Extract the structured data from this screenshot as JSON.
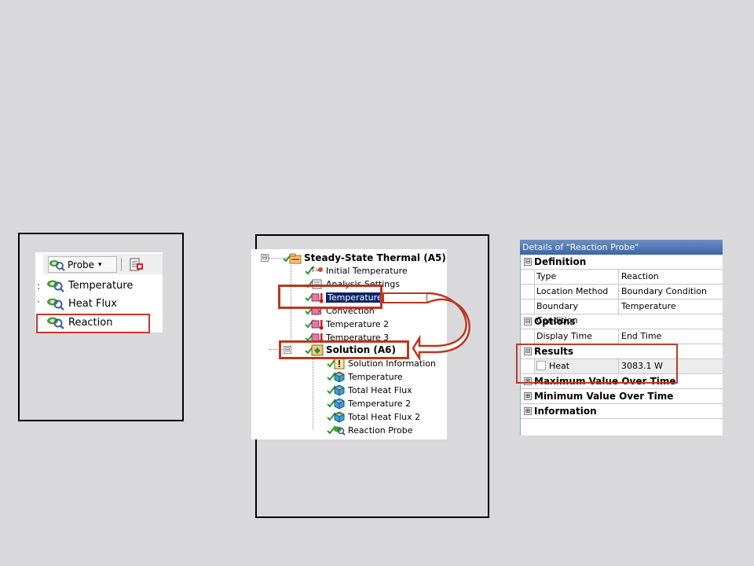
{
  "probe_menu": {
    "button_label": "Probe",
    "dropdown_glyph": "▾",
    "stub_glyphs": [
      ":",
      "·"
    ],
    "items": [
      {
        "label": "Temperature",
        "icon": "probe-icon"
      },
      {
        "label": "Heat Flux",
        "icon": "probe-icon"
      },
      {
        "label": "Reaction",
        "icon": "probe-icon"
      }
    ],
    "highlighted_item": "Reaction"
  },
  "tree": {
    "root": {
      "label": "Steady-State Thermal (A5)",
      "icon": "thermal-folder-icon",
      "expander": "⊟"
    },
    "analysis_children": [
      {
        "label": "Initial Temperature",
        "icon": "initial-temp-icon"
      },
      {
        "label": "Analysis Settings",
        "icon": "settings-icon"
      },
      {
        "label": "Temperature",
        "icon": "temperature-bc-icon",
        "selected": true
      },
      {
        "label": "Convection",
        "icon": "convection-icon"
      },
      {
        "label": "Temperature 2",
        "icon": "temperature-bc-icon"
      },
      {
        "label": "Temperature 3",
        "icon": "temperature-bc-icon"
      }
    ],
    "solution": {
      "label": "Solution (A6)",
      "icon": "solution-icon",
      "expander": "⊟"
    },
    "solution_children": [
      {
        "label": "Solution Information",
        "icon": "info-icon"
      },
      {
        "label": "Temperature",
        "icon": "result-icon"
      },
      {
        "label": "Total Heat Flux",
        "icon": "result-icon"
      },
      {
        "label": "Temperature 2",
        "icon": "result-icon"
      },
      {
        "label": "Total Heat Flux 2",
        "icon": "result-icon"
      },
      {
        "label": "Reaction Probe",
        "icon": "probe-icon"
      }
    ]
  },
  "details": {
    "title": "Details of \"Reaction Probe\"",
    "groups": [
      {
        "name": "Definition",
        "expander": "⊟",
        "rows": [
          {
            "key": "Type",
            "value": "Reaction"
          },
          {
            "key": "Location Method",
            "value": "Boundary Condition"
          },
          {
            "key": "Boundary Condition",
            "value": "Temperature"
          }
        ]
      },
      {
        "name": "Options",
        "expander": "⊟",
        "rows": [
          {
            "key": "Display Time",
            "value": "End Time"
          }
        ]
      },
      {
        "name": "Results",
        "expander": "⊟",
        "rows": [
          {
            "key": "Heat",
            "value": "3083.1 W"
          }
        ]
      },
      {
        "name": "Maximum Value Over Time",
        "expander": "⊞",
        "rows": []
      },
      {
        "name": "Minimum Value Over Time",
        "expander": "⊞",
        "rows": []
      },
      {
        "name": "Information",
        "expander": "⊞",
        "rows": []
      }
    ]
  },
  "colors": {
    "background": "#d9d9dc",
    "highlight": "#c0392b",
    "selection": "#0a246a",
    "title_bar": "#3b64a8"
  }
}
